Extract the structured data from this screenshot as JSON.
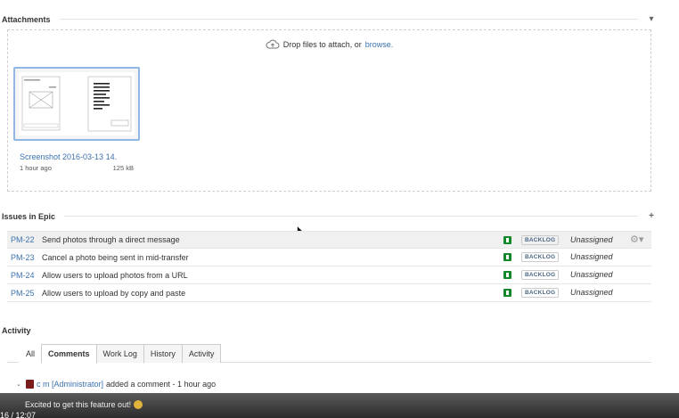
{
  "attachments": {
    "title": "Attachments",
    "drop_text": "Drop files to attach, or",
    "browse_link": "browse.",
    "file": {
      "name": "Screenshot 2016-03-13 14.",
      "age": "1 hour ago",
      "size": "125 kB"
    }
  },
  "issues": {
    "title": "Issues in Epic",
    "add_icon": "plus-icon",
    "rows": [
      {
        "key": "PM-22",
        "summary": "Send photos through a direct message",
        "status": "BACKLOG",
        "assignee": "Unassigned"
      },
      {
        "key": "PM-23",
        "summary": "Cancel a photo being sent in mid-transfer",
        "status": "BACKLOG",
        "assignee": "Unassigned"
      },
      {
        "key": "PM-24",
        "summary": "Allow users to upload photos from a URL",
        "status": "BACKLOG",
        "assignee": "Unassigned"
      },
      {
        "key": "PM-25",
        "summary": "Allow users to upload by copy and paste",
        "status": "BACKLOG",
        "assignee": "Unassigned"
      }
    ]
  },
  "activity": {
    "title": "Activity",
    "tabs": [
      "All",
      "Comments",
      "Work Log",
      "History",
      "Activity"
    ],
    "active_tab": "Comments",
    "comment": {
      "author": "c m [Administrator]",
      "action": "added a comment - 1 hour ago",
      "body": "Excited to get this feature out!"
    }
  },
  "player": {
    "time": "16 / 12:07"
  },
  "colors": {
    "link": "#3b73af",
    "status_green": "#14892c",
    "selection_border": "#8fb8e6"
  }
}
